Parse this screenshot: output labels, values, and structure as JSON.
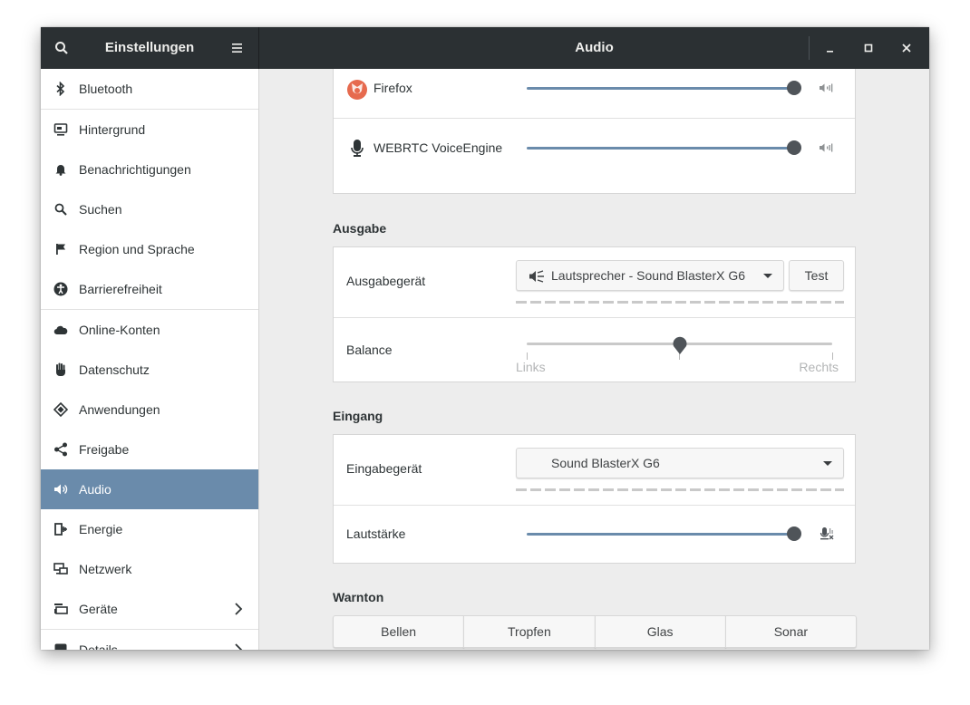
{
  "header": {
    "left_title": "Einstellungen",
    "title": "Audio"
  },
  "sidebar": {
    "items": [
      {
        "label": "Bluetooth",
        "icon": "bluetooth-icon"
      },
      {
        "label": "Hintergrund",
        "icon": "background-icon"
      },
      {
        "label": "Benachrichtigungen",
        "icon": "bell-icon"
      },
      {
        "label": "Suchen",
        "icon": "search-icon"
      },
      {
        "label": "Region und Sprache",
        "icon": "flag-icon"
      },
      {
        "label": "Barrierefreiheit",
        "icon": "accessibility-icon"
      },
      {
        "label": "Online-Konten",
        "icon": "cloud-icon"
      },
      {
        "label": "Datenschutz",
        "icon": "hand-icon"
      },
      {
        "label": "Anwendungen",
        "icon": "applications-icon"
      },
      {
        "label": "Freigabe",
        "icon": "share-icon"
      },
      {
        "label": "Audio",
        "icon": "speaker-icon",
        "active": true
      },
      {
        "label": "Energie",
        "icon": "power-icon"
      },
      {
        "label": "Netzwerk",
        "icon": "network-icon"
      },
      {
        "label": "Geräte",
        "icon": "devices-icon"
      },
      {
        "label": "Details",
        "icon": "details-icon"
      }
    ]
  },
  "apps": {
    "items": [
      {
        "name": "Firefox",
        "level": 1.0
      },
      {
        "name": "WEBRTC VoiceEngine",
        "level": 1.0
      }
    ]
  },
  "output": {
    "section_title": "Ausgabe",
    "device_label": "Ausgabegerät",
    "device_value": "Lautsprecher - Sound BlasterX G6",
    "test_label": "Test",
    "balance_label": "Balance",
    "balance_left": "Links",
    "balance_right": "Rechts",
    "balance_value": 0.5
  },
  "input": {
    "section_title": "Eingang",
    "device_label": "Eingabegerät",
    "device_value": "Sound BlasterX G6",
    "volume_label": "Lautstärke",
    "volume_level": 1.0
  },
  "alert": {
    "section_title": "Warnton",
    "options": [
      "Bellen",
      "Tropfen",
      "Glas",
      "Sonar"
    ]
  },
  "colors": {
    "accent": "#6a8bab",
    "headerbar": "#2b3033"
  }
}
